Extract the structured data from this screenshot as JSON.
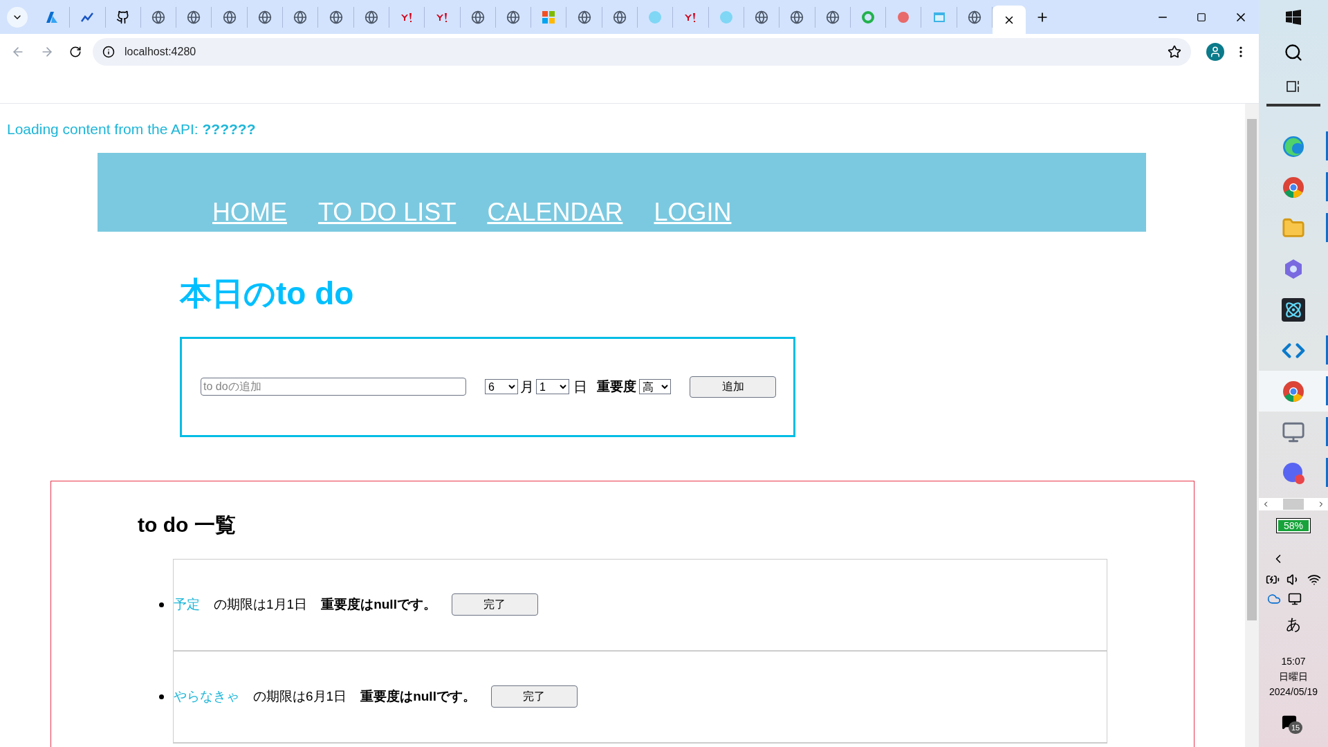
{
  "browser": {
    "tabs": [
      {
        "kind": "azure",
        "selected": false
      },
      {
        "kind": "chart",
        "selected": false
      },
      {
        "kind": "github",
        "selected": false
      },
      {
        "kind": "globe",
        "selected": false
      },
      {
        "kind": "globe",
        "selected": false
      },
      {
        "kind": "globe",
        "selected": false
      },
      {
        "kind": "globe",
        "selected": false
      },
      {
        "kind": "globe",
        "selected": false
      },
      {
        "kind": "globe",
        "selected": false
      },
      {
        "kind": "globe",
        "selected": false
      },
      {
        "kind": "yahoo",
        "selected": false
      },
      {
        "kind": "yahoo",
        "selected": false
      },
      {
        "kind": "globe",
        "selected": false
      },
      {
        "kind": "globe",
        "selected": false
      },
      {
        "kind": "squares",
        "selected": false
      },
      {
        "kind": "globe",
        "selected": false
      },
      {
        "kind": "globe",
        "selected": false
      },
      {
        "kind": "orb",
        "selected": false
      },
      {
        "kind": "yahoo",
        "selected": false
      },
      {
        "kind": "orb",
        "selected": false
      },
      {
        "kind": "globe",
        "selected": false
      },
      {
        "kind": "globe",
        "selected": false
      },
      {
        "kind": "globe",
        "selected": false
      },
      {
        "kind": "ring",
        "selected": false
      },
      {
        "kind": "blob",
        "selected": false
      },
      {
        "kind": "window",
        "selected": false
      },
      {
        "kind": "globe",
        "selected": false
      },
      {
        "selected": true
      }
    ],
    "address": "localhost:4280"
  },
  "page": {
    "api_status": {
      "label": "Loading content from the API:",
      "value": "??????"
    },
    "nav": [
      "HOME",
      "TO DO LIST",
      "CALENDAR",
      "LOGIN"
    ],
    "heading": "本日のto do",
    "add_form": {
      "placeholder": "to doの追加",
      "month": "6",
      "month_unit": "月",
      "day": "1",
      "day_unit": "日",
      "priority_label": "重要度",
      "priority": "高",
      "button": "追加"
    },
    "list": {
      "heading": "to do 一覧",
      "items": [
        {
          "name": "予定",
          "due": "の期限は1月1日",
          "priority": "重要度はnullです。",
          "button": "完了"
        },
        {
          "name": "やらなきゃ",
          "due": "の期限は6月1日",
          "priority": "重要度はnullです。",
          "button": "完了"
        }
      ]
    }
  },
  "taskbar": {
    "apps": [
      {
        "kind": "edge",
        "running": true,
        "selected": false
      },
      {
        "kind": "chrome",
        "running": true,
        "selected": false
      },
      {
        "kind": "folder",
        "running": true,
        "selected": false
      },
      {
        "kind": "copilot",
        "running": false,
        "selected": false
      },
      {
        "kind": "react",
        "running": false,
        "selected": false
      },
      {
        "kind": "vscode",
        "running": true,
        "selected": false
      },
      {
        "kind": "chrome",
        "running": true,
        "selected": true
      },
      {
        "kind": "monitor",
        "running": true,
        "selected": false
      },
      {
        "kind": "discord",
        "running": true,
        "selected": false
      }
    ],
    "battery": "58%",
    "ime": "あ",
    "time": "15:07",
    "weekday": "日曜日",
    "date": "2024/05/19",
    "notifications": "15"
  }
}
